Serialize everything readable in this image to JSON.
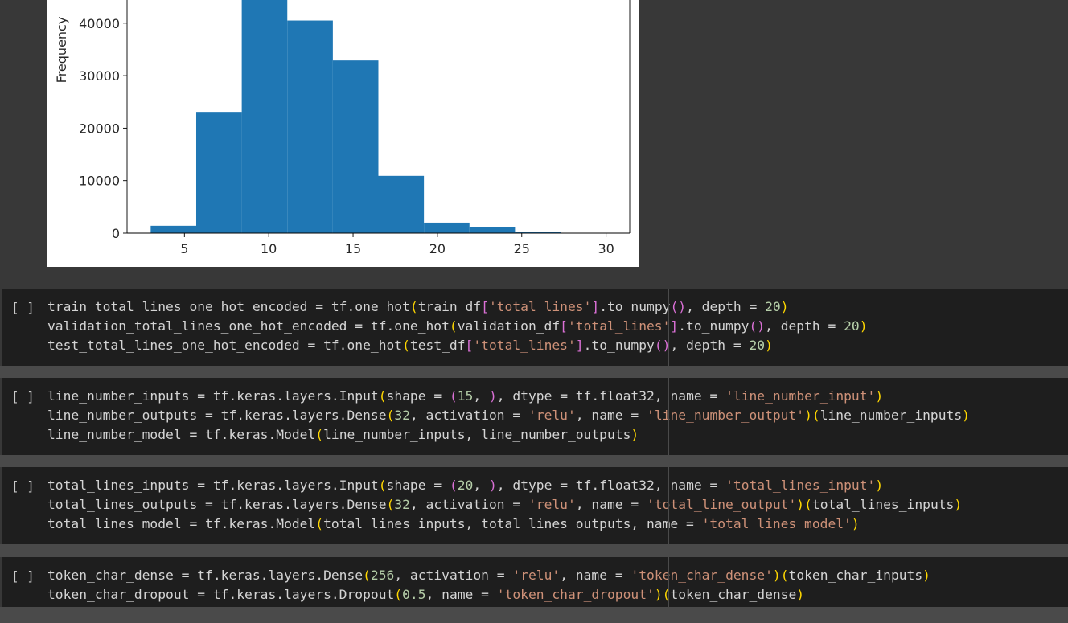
{
  "chart_data": {
    "type": "bar",
    "title": "",
    "xlabel": "",
    "ylabel": "Frequency",
    "x_ticks": [
      "5",
      "10",
      "15",
      "20",
      "25",
      "30"
    ],
    "y_ticks": [
      "0",
      "10000",
      "20000",
      "30000",
      "40000"
    ],
    "xlim": [
      1.6,
      31.4
    ],
    "ylim": [
      0,
      48000
    ],
    "bin_edges": [
      3.0,
      5.7,
      8.4,
      11.1,
      13.8,
      16.5,
      19.2,
      21.9,
      24.6,
      27.3,
      30.0
    ],
    "values": [
      1400,
      23100,
      48000,
      40500,
      32900,
      10900,
      2000,
      1200,
      250,
      50
    ],
    "bar_color": "#1f77b4"
  },
  "cells": [
    {
      "run_label": "[ ]",
      "lines": [
        "train_total_lines_one_hot_encoded = tf.one_hot(train_df['total_lines'].to_numpy(), depth = 20)",
        "validation_total_lines_one_hot_encoded = tf.one_hot(validation_df['total_lines'].to_numpy(), depth = 20)",
        "test_total_lines_one_hot_encoded = tf.one_hot(test_df['total_lines'].to_numpy(), depth = 20)"
      ]
    },
    {
      "run_label": "[ ]",
      "lines": [
        "line_number_inputs = tf.keras.layers.Input(shape = (15, ), dtype = tf.float32, name = 'line_number_input')",
        "line_number_outputs = tf.keras.layers.Dense(32, activation = 'relu', name = 'line_number_output')(line_number_inputs)",
        "line_number_model = tf.keras.Model(line_number_inputs, line_number_outputs)"
      ]
    },
    {
      "run_label": "[ ]",
      "lines": [
        "total_lines_inputs = tf.keras.layers.Input(shape = (20, ), dtype = tf.float32, name = 'total_lines_input')",
        "total_lines_outputs = tf.keras.layers.Dense(32, activation = 'relu', name = 'total_line_output')(total_lines_inputs)",
        "total_lines_model = tf.keras.Model(total_lines_inputs, total_lines_outputs, name = 'total_lines_model')"
      ]
    },
    {
      "run_label": "[ ]",
      "lines": [
        "token_char_dense = tf.keras.layers.Dense(256, activation = 'relu', name = 'token_char_dense')(token_char_inputs)",
        "token_char_dropout = tf.keras.layers.Dropout(0.5, name = 'token_char_dropout')(token_char_dense)"
      ]
    }
  ]
}
